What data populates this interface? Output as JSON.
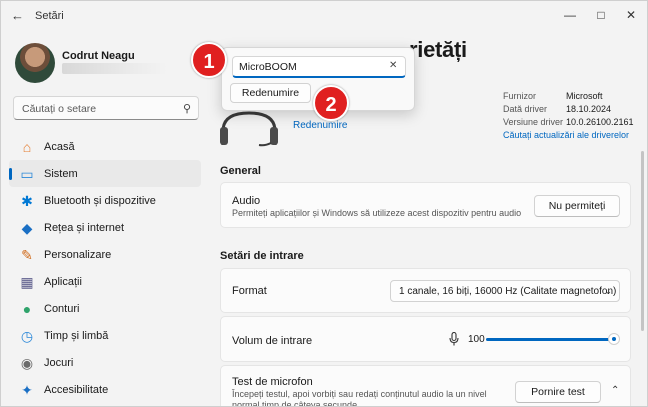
{
  "window": {
    "title": "Setări"
  },
  "user": {
    "name": "Codrut Neagu"
  },
  "search": {
    "placeholder": "Căutați o setare"
  },
  "nav": {
    "items": [
      {
        "label": "Acasă",
        "icon": "home-icon",
        "color": "#e57b2e"
      },
      {
        "label": "Sistem",
        "icon": "system-icon",
        "color": "#2b88d8",
        "active": true
      },
      {
        "label": "Bluetooth și dispozitive",
        "icon": "bluetooth-icon",
        "color": "#0078d4"
      },
      {
        "label": "Rețea și internet",
        "icon": "wifi-icon",
        "color": "#1a6fc4"
      },
      {
        "label": "Personalizare",
        "icon": "brush-icon",
        "color": "#d06a1a"
      },
      {
        "label": "Aplicații",
        "icon": "apps-icon",
        "color": "#5b5b8a"
      },
      {
        "label": "Conturi",
        "icon": "accounts-icon",
        "color": "#2fa36b"
      },
      {
        "label": "Timp și limbă",
        "icon": "time-language-icon",
        "color": "#2b88d8"
      },
      {
        "label": "Jocuri",
        "icon": "gaming-icon",
        "color": "#6b6b6b"
      },
      {
        "label": "Accesibilitate",
        "icon": "accessibility-icon",
        "color": "#1a6fc4"
      }
    ]
  },
  "header": {
    "title_fragment": "rietăți"
  },
  "device": {
    "rename_link": "Redenumire",
    "info": [
      {
        "key": "Furnizor",
        "value": "Microsoft"
      },
      {
        "key": "Dată driver",
        "value": "18.10.2024"
      },
      {
        "key": "Versiune driver",
        "value": "10.0.26100.2161"
      }
    ],
    "driver_update_link": "Căutați actualizări ale driverelor"
  },
  "rename_popup": {
    "input_value": "MicroBOOM",
    "button_label": "Redenumire"
  },
  "badges": {
    "one": "1",
    "two": "2"
  },
  "general": {
    "heading": "General",
    "audio_title": "Audio",
    "audio_desc": "Permiteți aplicațiilor și Windows să utilizeze acest dispozitiv pentru audio",
    "audio_button": "Nu permiteți"
  },
  "input_settings": {
    "heading": "Setări de intrare",
    "format_label": "Format",
    "format_value": "1 canale, 16 biți, 16000 Hz (Calitate magnetofon)",
    "volume_label": "Volum de intrare",
    "volume_value": "100",
    "volume_level": 1.0,
    "mic_test_title": "Test de microfon",
    "mic_test_desc": "Începeți testul, apoi vorbiți sau redați conținutul audio la un nivel normal timp de câteva secunde",
    "mic_test_button": "Pornire test"
  },
  "colors": {
    "accent": "#0067c0",
    "badge": "#e02020"
  }
}
